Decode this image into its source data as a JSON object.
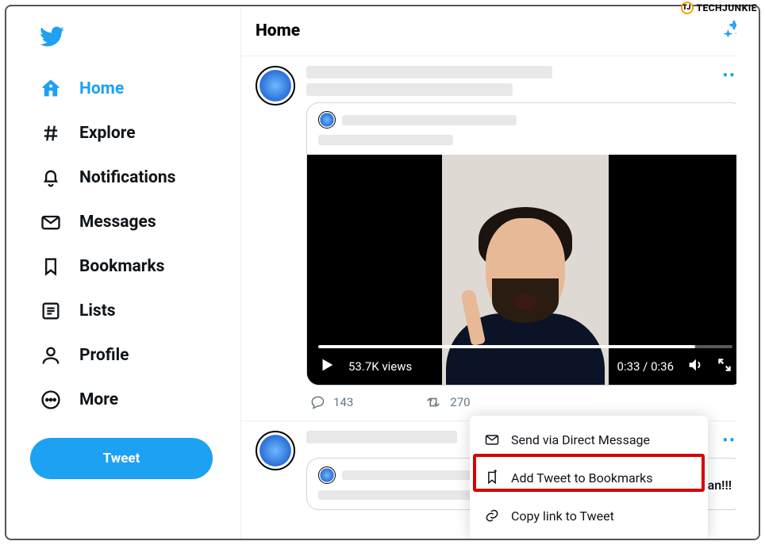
{
  "watermark": {
    "text": "TECHJUNKIE",
    "logo_letters": "TJ"
  },
  "sidebar": {
    "items": [
      {
        "label": "Home"
      },
      {
        "label": "Explore"
      },
      {
        "label": "Notifications"
      },
      {
        "label": "Messages"
      },
      {
        "label": "Bookmarks"
      },
      {
        "label": "Lists"
      },
      {
        "label": "Profile"
      },
      {
        "label": "More"
      }
    ],
    "tweet_button": "Tweet"
  },
  "header": {
    "title": "Home"
  },
  "tweet1": {
    "views_label": "53.7K views",
    "time_label": "0:33 / 0:36",
    "replies": "143",
    "retweets": "270"
  },
  "share_menu": {
    "dm": "Send via Direct Message",
    "bookmark": "Add Tweet to Bookmarks",
    "copy": "Copy link to Tweet"
  },
  "tweet2_tail": "aaan!!!"
}
